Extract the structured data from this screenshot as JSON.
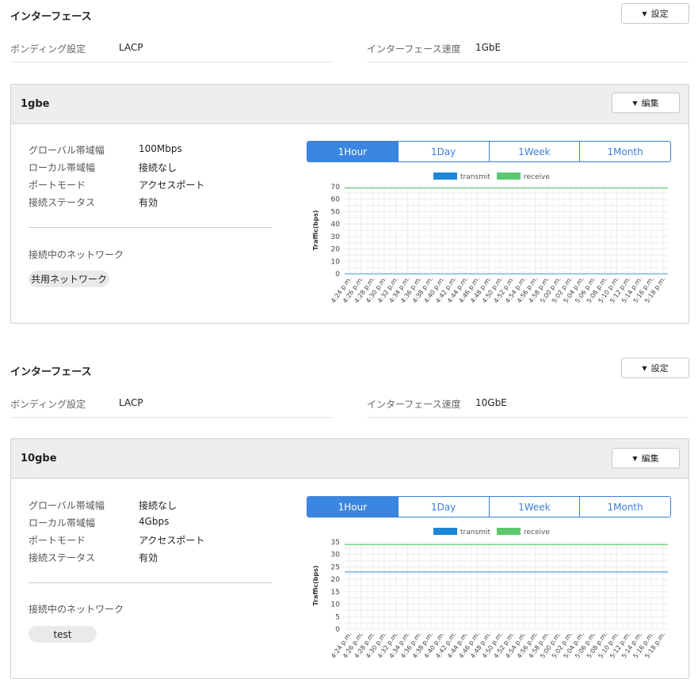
{
  "colors": {
    "accent": "#3b86e0",
    "transmit": "#5aaee0",
    "receive": "#5cc96e"
  },
  "sections": [
    {
      "title": "インターフェース",
      "settings_label": "設定",
      "bonding_label": "ボンディング設定",
      "bonding_value": "LACP",
      "speed_label": "インターフェース速度",
      "speed_value": "1GbE",
      "card": {
        "name": "1gbe",
        "edit_label": "編集",
        "rows": [
          {
            "label": "グローバル帯域幅",
            "value": "100Mbps"
          },
          {
            "label": "ローカル帯域幅",
            "value": "接続なし"
          },
          {
            "label": "ポートモード",
            "value": "アクセスポート"
          },
          {
            "label": "接続ステータス",
            "value": "有効"
          }
        ],
        "network_label": "接続中のネットワーク",
        "network_chip": "共用ネットワーク",
        "tabs": [
          "1Hour",
          "1Day",
          "1Week",
          "1Month"
        ],
        "active_tab": "1Hour"
      }
    },
    {
      "title": "インターフェース",
      "settings_label": "設定",
      "bonding_label": "ボンディング設定",
      "bonding_value": "LACP",
      "speed_label": "インターフェース速度",
      "speed_value": "10GbE",
      "card": {
        "name": "10gbe",
        "edit_label": "編集",
        "rows": [
          {
            "label": "グローバル帯域幅",
            "value": "接続なし"
          },
          {
            "label": "ローカル帯域幅",
            "value": "4Gbps"
          },
          {
            "label": "ポートモード",
            "value": "アクセスポート"
          },
          {
            "label": "接続ステータス",
            "value": "有効"
          }
        ],
        "network_label": "接続中のネットワーク",
        "network_chip": "test",
        "tabs": [
          "1Hour",
          "1Day",
          "1Week",
          "1Month"
        ],
        "active_tab": "1Hour"
      }
    }
  ],
  "chart_data": [
    {
      "type": "line",
      "ylabel": "Traffic(bps)",
      "legend_position": "top",
      "ylim": [
        0,
        70
      ],
      "yticks": [
        0,
        10,
        20,
        30,
        40,
        50,
        60,
        70
      ],
      "x": [
        "4:24 p.m.",
        "4:26 p.m.",
        "4:28 p.m.",
        "4:30 p.m.",
        "4:32 p.m.",
        "4:34 p.m.",
        "4:36 p.m.",
        "4:38 p.m.",
        "4:40 p.m.",
        "4:42 p.m.",
        "4:44 p.m.",
        "4:46 p.m.",
        "4:48 p.m.",
        "4:50 p.m.",
        "4:52 p.m.",
        "4:54 p.m.",
        "4:56 p.m.",
        "4:58 p.m.",
        "5:00 p.m.",
        "5:02 p.m.",
        "5:04 p.m.",
        "5:06 p.m.",
        "5:08 p.m.",
        "5:10 p.m.",
        "5:12 p.m.",
        "5:14 p.m.",
        "5:16 p.m.",
        "5:18 p.m."
      ],
      "series": [
        {
          "name": "transmit",
          "constant": 0
        },
        {
          "name": "receive",
          "constant": 69
        }
      ]
    },
    {
      "type": "line",
      "ylabel": "Traffic(bps)",
      "legend_position": "top",
      "ylim": [
        0,
        35
      ],
      "yticks": [
        0,
        5,
        10,
        15,
        20,
        25,
        30,
        35
      ],
      "x": [
        "4:24 p.m.",
        "4:26 p.m.",
        "4:28 p.m.",
        "4:30 p.m.",
        "4:32 p.m.",
        "4:34 p.m.",
        "4:36 p.m.",
        "4:38 p.m.",
        "4:40 p.m.",
        "4:42 p.m.",
        "4:44 p.m.",
        "4:46 p.m.",
        "4:48 p.m.",
        "4:50 p.m.",
        "4:52 p.m.",
        "4:54 p.m.",
        "4:56 p.m.",
        "4:58 p.m.",
        "5:00 p.m.",
        "5:02 p.m.",
        "5:04 p.m.",
        "5:06 p.m.",
        "5:08 p.m.",
        "5:10 p.m.",
        "5:12 p.m.",
        "5:14 p.m.",
        "5:16 p.m.",
        "5:18 p.m."
      ],
      "series": [
        {
          "name": "transmit",
          "constant": 23
        },
        {
          "name": "receive",
          "constant": 34
        }
      ]
    }
  ]
}
